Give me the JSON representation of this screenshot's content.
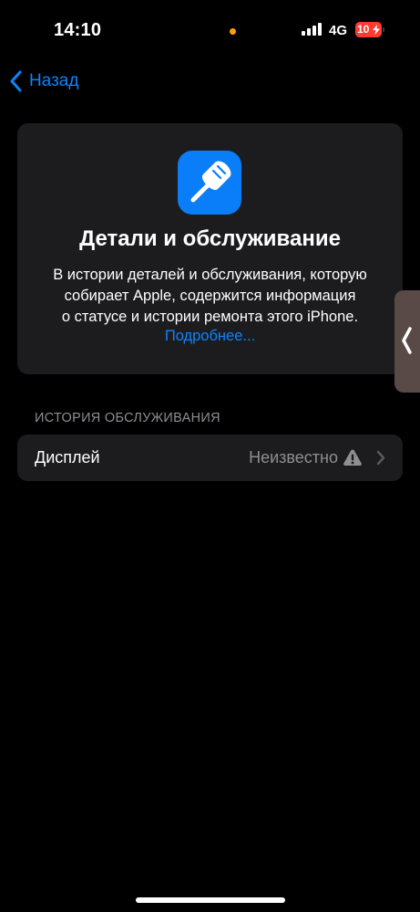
{
  "status_bar": {
    "time": "14:10",
    "network": "4G",
    "battery_level": "10",
    "battery_fraction": 0.1,
    "privacy_indicator_color": "#ff9f0a"
  },
  "nav": {
    "back_label": "Назад"
  },
  "info_card": {
    "icon": "screwdriver-icon",
    "title": "Детали и обслуживание",
    "description_lines": [
      "В истории деталей и обслуживания, которую",
      "собирает Apple, содержится информация",
      "о статусе и истории ремонта этого iPhone."
    ],
    "link_label": "Подробнее..."
  },
  "service_history": {
    "header": "ИСТОРИЯ ОБСЛУЖИВАНИЯ",
    "rows": [
      {
        "label": "Дисплей",
        "value": "Неизвестно",
        "status_icon": "warning-icon"
      }
    ]
  },
  "colors": {
    "accent": "#0a84ff",
    "card_background": "#1c1c1e",
    "secondary_text": "#8e8e93",
    "battery_low": "#ff3b30"
  }
}
